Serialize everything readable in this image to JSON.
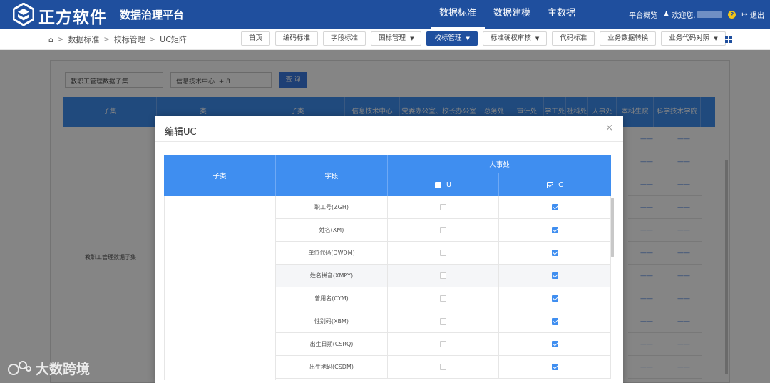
{
  "header": {
    "brand": "正方软件",
    "platform": "数据治理平台",
    "nav": [
      "数据标准",
      "数据建模",
      "主数据"
    ],
    "active_nav": 0,
    "overview": "平台概览",
    "welcome": "欢迎您,",
    "logout": "退出"
  },
  "breadcrumb": [
    "数据标准",
    "校标管理",
    "UC矩阵"
  ],
  "subnav": [
    {
      "label": "首页",
      "dropdown": false
    },
    {
      "label": "编码标准",
      "dropdown": false
    },
    {
      "label": "字段标准",
      "dropdown": false
    },
    {
      "label": "国标管理",
      "dropdown": true
    },
    {
      "label": "校标管理",
      "dropdown": true,
      "active": true
    },
    {
      "label": "标准确权审核",
      "dropdown": true
    },
    {
      "label": "代码标准",
      "dropdown": false
    },
    {
      "label": "业务数据转换",
      "dropdown": false
    },
    {
      "label": "业务代码对照",
      "dropdown": true
    }
  ],
  "background": {
    "filter_subset": "教职工管理数据子集",
    "filter_dept": "信息技术中心",
    "filter_count": "+ 8",
    "query_button": "查 询",
    "columns": [
      "子集",
      "类",
      "子类",
      "信息技术中心",
      "党委办公室、校长办公室",
      "总务处",
      "审计处",
      "学工处",
      "社科处",
      "人事处",
      "本科生院",
      "科学技术学院"
    ],
    "row_label": "教职工管理数据子集"
  },
  "modal": {
    "title": "编辑UC",
    "close": "×",
    "headers": {
      "subclass": "子类",
      "field": "字段",
      "dept": "人事处",
      "u": "U",
      "c": "C"
    },
    "rows": [
      {
        "field": "职工号(ZGH)",
        "u": false,
        "c": true
      },
      {
        "field": "姓名(XM)",
        "u": false,
        "c": true
      },
      {
        "field": "单位代码(DWDM)",
        "u": false,
        "c": true
      },
      {
        "field": "姓名拼音(XMPY)",
        "u": false,
        "c": true
      },
      {
        "field": "曾用名(CYM)",
        "u": false,
        "c": true
      },
      {
        "field": "性别码(XBM)",
        "u": false,
        "c": true
      },
      {
        "field": "出生日期(CSRQ)",
        "u": false,
        "c": true
      },
      {
        "field": "出生地码(CSDM)",
        "u": false,
        "c": true
      }
    ]
  },
  "watermark": "大数跨境"
}
